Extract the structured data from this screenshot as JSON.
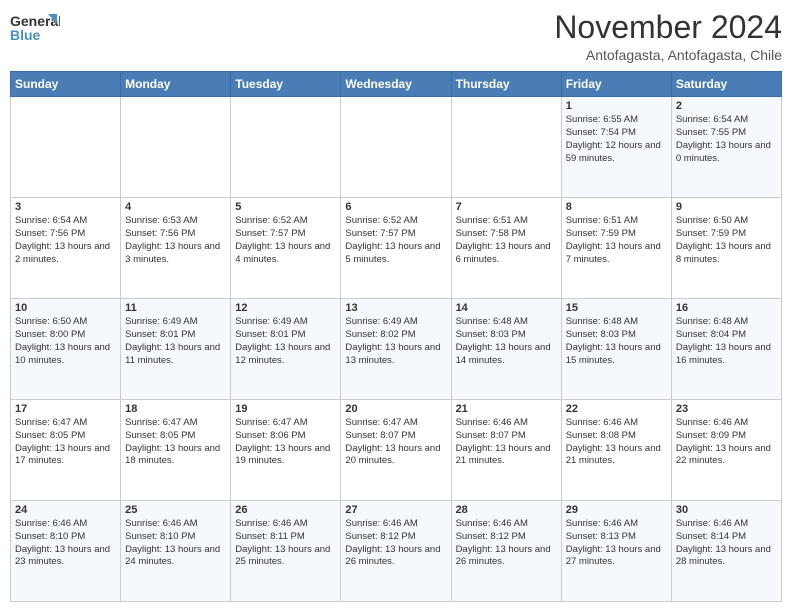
{
  "logo": {
    "line1": "General",
    "line2": "Blue"
  },
  "title": "November 2024",
  "location": "Antofagasta, Antofagasta, Chile",
  "days_of_week": [
    "Sunday",
    "Monday",
    "Tuesday",
    "Wednesday",
    "Thursday",
    "Friday",
    "Saturday"
  ],
  "weeks": [
    [
      {
        "day": "",
        "info": ""
      },
      {
        "day": "",
        "info": ""
      },
      {
        "day": "",
        "info": ""
      },
      {
        "day": "",
        "info": ""
      },
      {
        "day": "",
        "info": ""
      },
      {
        "day": "1",
        "info": "Sunrise: 6:55 AM\nSunset: 7:54 PM\nDaylight: 12 hours and 59 minutes."
      },
      {
        "day": "2",
        "info": "Sunrise: 6:54 AM\nSunset: 7:55 PM\nDaylight: 13 hours and 0 minutes."
      }
    ],
    [
      {
        "day": "3",
        "info": "Sunrise: 6:54 AM\nSunset: 7:56 PM\nDaylight: 13 hours and 2 minutes."
      },
      {
        "day": "4",
        "info": "Sunrise: 6:53 AM\nSunset: 7:56 PM\nDaylight: 13 hours and 3 minutes."
      },
      {
        "day": "5",
        "info": "Sunrise: 6:52 AM\nSunset: 7:57 PM\nDaylight: 13 hours and 4 minutes."
      },
      {
        "day": "6",
        "info": "Sunrise: 6:52 AM\nSunset: 7:57 PM\nDaylight: 13 hours and 5 minutes."
      },
      {
        "day": "7",
        "info": "Sunrise: 6:51 AM\nSunset: 7:58 PM\nDaylight: 13 hours and 6 minutes."
      },
      {
        "day": "8",
        "info": "Sunrise: 6:51 AM\nSunset: 7:59 PM\nDaylight: 13 hours and 7 minutes."
      },
      {
        "day": "9",
        "info": "Sunrise: 6:50 AM\nSunset: 7:59 PM\nDaylight: 13 hours and 8 minutes."
      }
    ],
    [
      {
        "day": "10",
        "info": "Sunrise: 6:50 AM\nSunset: 8:00 PM\nDaylight: 13 hours and 10 minutes."
      },
      {
        "day": "11",
        "info": "Sunrise: 6:49 AM\nSunset: 8:01 PM\nDaylight: 13 hours and 11 minutes."
      },
      {
        "day": "12",
        "info": "Sunrise: 6:49 AM\nSunset: 8:01 PM\nDaylight: 13 hours and 12 minutes."
      },
      {
        "day": "13",
        "info": "Sunrise: 6:49 AM\nSunset: 8:02 PM\nDaylight: 13 hours and 13 minutes."
      },
      {
        "day": "14",
        "info": "Sunrise: 6:48 AM\nSunset: 8:03 PM\nDaylight: 13 hours and 14 minutes."
      },
      {
        "day": "15",
        "info": "Sunrise: 6:48 AM\nSunset: 8:03 PM\nDaylight: 13 hours and 15 minutes."
      },
      {
        "day": "16",
        "info": "Sunrise: 6:48 AM\nSunset: 8:04 PM\nDaylight: 13 hours and 16 minutes."
      }
    ],
    [
      {
        "day": "17",
        "info": "Sunrise: 6:47 AM\nSunset: 8:05 PM\nDaylight: 13 hours and 17 minutes."
      },
      {
        "day": "18",
        "info": "Sunrise: 6:47 AM\nSunset: 8:05 PM\nDaylight: 13 hours and 18 minutes."
      },
      {
        "day": "19",
        "info": "Sunrise: 6:47 AM\nSunset: 8:06 PM\nDaylight: 13 hours and 19 minutes."
      },
      {
        "day": "20",
        "info": "Sunrise: 6:47 AM\nSunset: 8:07 PM\nDaylight: 13 hours and 20 minutes."
      },
      {
        "day": "21",
        "info": "Sunrise: 6:46 AM\nSunset: 8:07 PM\nDaylight: 13 hours and 21 minutes."
      },
      {
        "day": "22",
        "info": "Sunrise: 6:46 AM\nSunset: 8:08 PM\nDaylight: 13 hours and 21 minutes."
      },
      {
        "day": "23",
        "info": "Sunrise: 6:46 AM\nSunset: 8:09 PM\nDaylight: 13 hours and 22 minutes."
      }
    ],
    [
      {
        "day": "24",
        "info": "Sunrise: 6:46 AM\nSunset: 8:10 PM\nDaylight: 13 hours and 23 minutes."
      },
      {
        "day": "25",
        "info": "Sunrise: 6:46 AM\nSunset: 8:10 PM\nDaylight: 13 hours and 24 minutes."
      },
      {
        "day": "26",
        "info": "Sunrise: 6:46 AM\nSunset: 8:11 PM\nDaylight: 13 hours and 25 minutes."
      },
      {
        "day": "27",
        "info": "Sunrise: 6:46 AM\nSunset: 8:12 PM\nDaylight: 13 hours and 26 minutes."
      },
      {
        "day": "28",
        "info": "Sunrise: 6:46 AM\nSunset: 8:12 PM\nDaylight: 13 hours and 26 minutes."
      },
      {
        "day": "29",
        "info": "Sunrise: 6:46 AM\nSunset: 8:13 PM\nDaylight: 13 hours and 27 minutes."
      },
      {
        "day": "30",
        "info": "Sunrise: 6:46 AM\nSunset: 8:14 PM\nDaylight: 13 hours and 28 minutes."
      }
    ]
  ]
}
